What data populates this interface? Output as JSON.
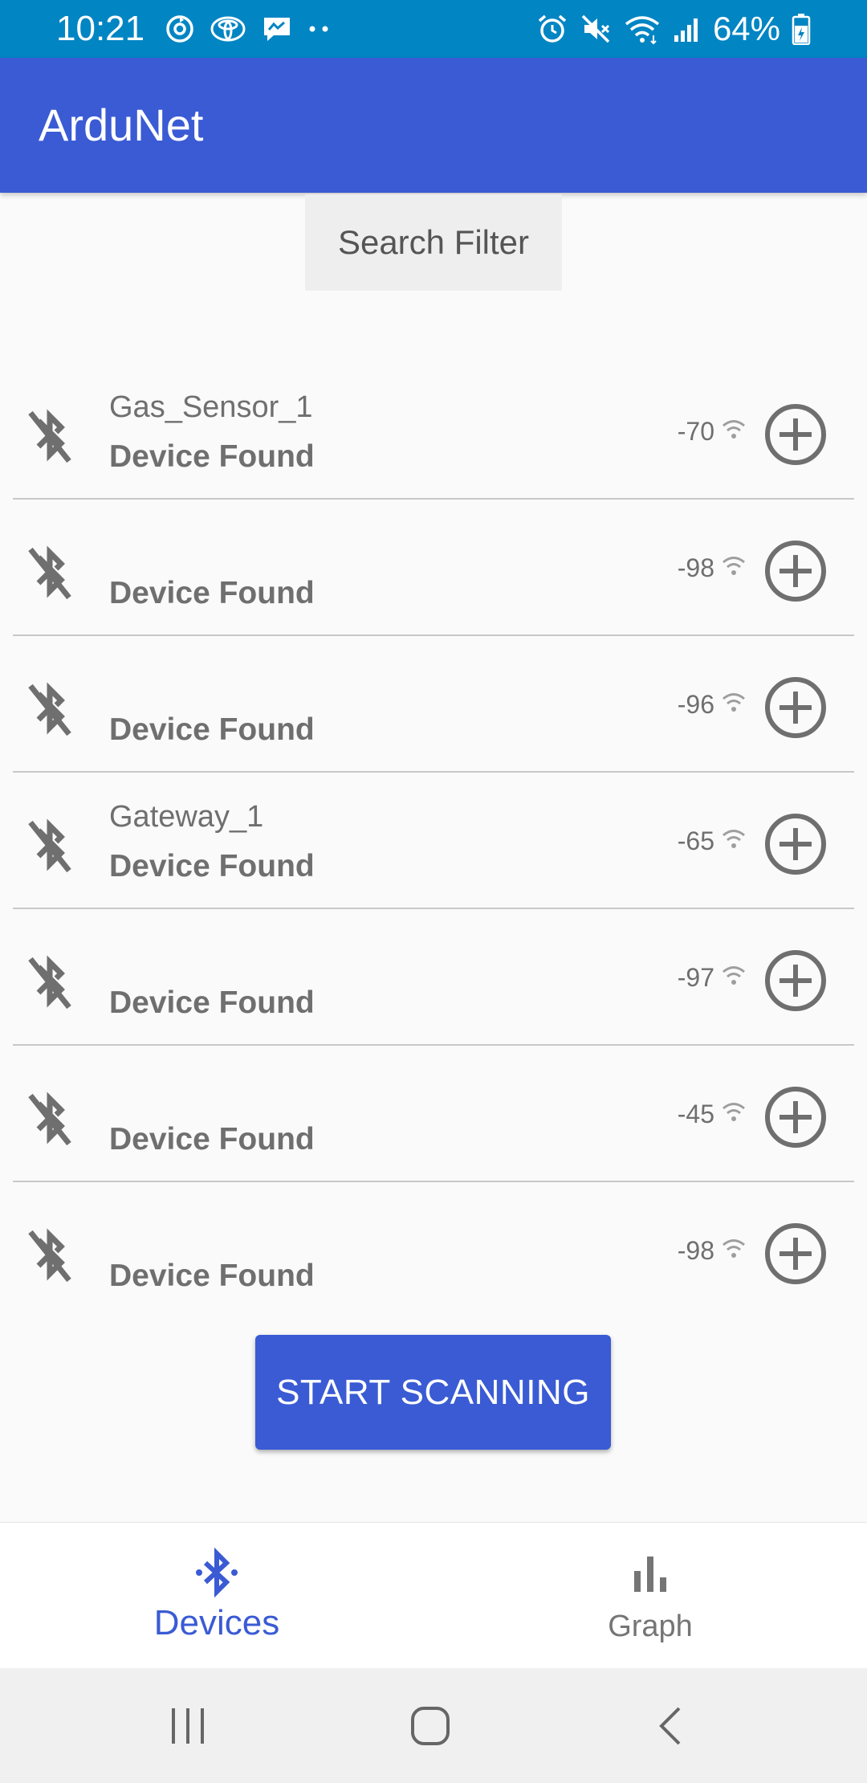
{
  "status_bar": {
    "time": "10:21",
    "battery": "64%",
    "left_icons": [
      "sync-icon",
      "toyota-logo-icon",
      "messenger-icon",
      "more-dots-icon"
    ],
    "right_icons": [
      "alarm-icon",
      "mute-icon",
      "wifi-icon",
      "signal-icon",
      "battery-icon"
    ]
  },
  "app_bar": {
    "title": "ArduNet"
  },
  "search_filter": {
    "label": "Search Filter"
  },
  "devices": [
    {
      "name": "Gas_Sensor_1",
      "status": "Device Found",
      "rssi": "-70"
    },
    {
      "name": "",
      "status": "Device Found",
      "rssi": "-98"
    },
    {
      "name": "",
      "status": "Device Found",
      "rssi": "-96"
    },
    {
      "name": "Gateway_1",
      "status": "Device Found",
      "rssi": "-65"
    },
    {
      "name": "",
      "status": "Device Found",
      "rssi": "-97"
    },
    {
      "name": "",
      "status": "Device Found",
      "rssi": "-45"
    },
    {
      "name": "",
      "status": "Device Found",
      "rssi": "-98"
    }
  ],
  "start_button": {
    "label": "START SCANNING"
  },
  "bottom_nav": {
    "items": [
      {
        "label": "Devices",
        "icon": "bluetooth-icon",
        "active": true
      },
      {
        "label": "Graph",
        "icon": "bar-chart-icon",
        "active": false
      }
    ]
  },
  "colors": {
    "status_bar": "#0285c3",
    "primary": "#3a5bd4",
    "text_gray": "#6f6f6f"
  }
}
